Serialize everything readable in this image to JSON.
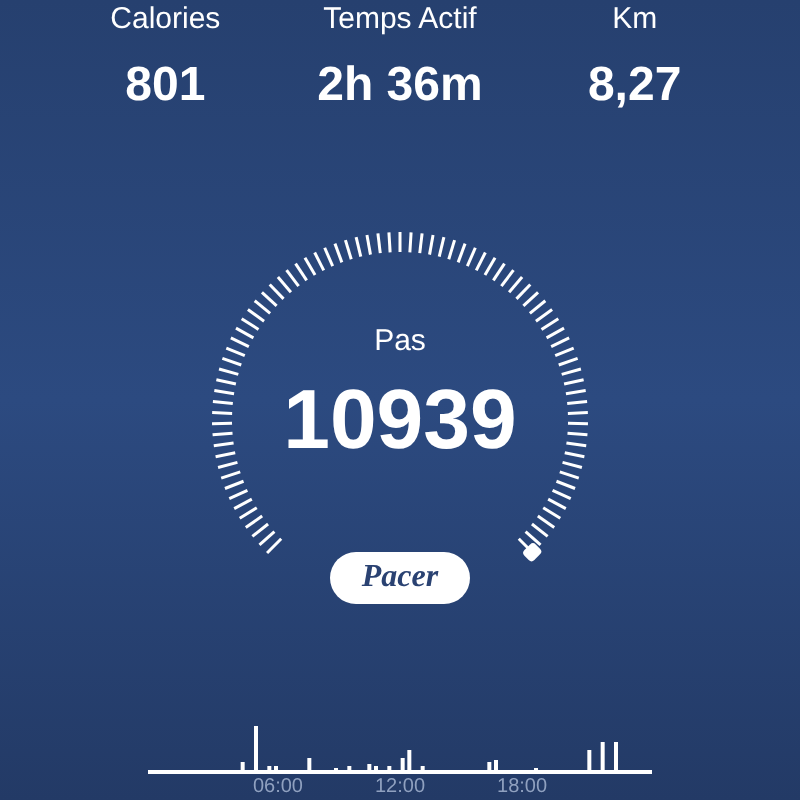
{
  "stats": [
    {
      "label": "Calories",
      "value": "801"
    },
    {
      "label": "Temps Actif",
      "value": "2h 36m"
    },
    {
      "label": "Km",
      "value": "8,27"
    }
  ],
  "steps": {
    "label": "Pas",
    "value": "10939"
  },
  "logo": "Pacer",
  "timeline": {
    "ticks": [
      "06:00",
      "12:00",
      "18:00"
    ]
  }
}
